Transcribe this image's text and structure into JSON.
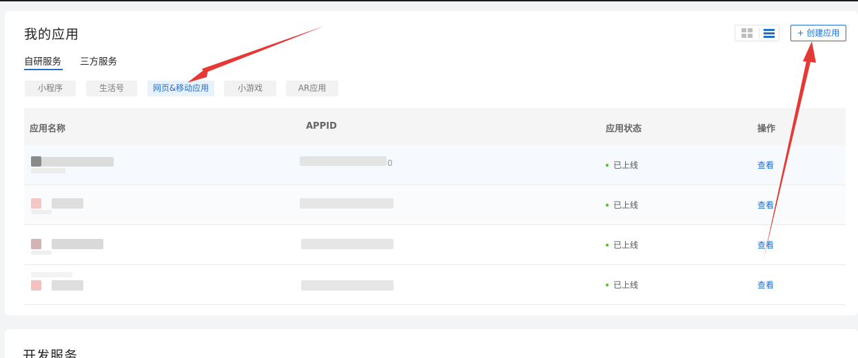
{
  "header": {
    "title": "我的应用",
    "create_button": "+ 创建应用"
  },
  "tabs": [
    {
      "label": "自研服务",
      "active": true
    },
    {
      "label": "三方服务",
      "active": false
    }
  ],
  "filters": [
    {
      "label": "小程序",
      "active": false
    },
    {
      "label": "生活号",
      "active": false
    },
    {
      "label": "网页&移动应用",
      "active": true
    },
    {
      "label": "小游戏",
      "active": false
    },
    {
      "label": "AR应用",
      "active": false
    }
  ],
  "table": {
    "columns": [
      "应用名称",
      "APPID",
      "应用状态",
      "操作"
    ],
    "rows": [
      {
        "appid_tail": "0",
        "status": "已上线",
        "action": "查看"
      },
      {
        "appid_tail": "",
        "status": "已上线",
        "action": "查看"
      },
      {
        "appid_tail": "",
        "status": "已上线",
        "action": "查看"
      },
      {
        "appid_tail": "",
        "status": "已上线",
        "action": "查看"
      }
    ]
  },
  "section2": {
    "title": "开发服务"
  },
  "colors": {
    "accent": "#1e6fd0",
    "status_online": "#52c41a",
    "annotation_arrow": "#e53935"
  },
  "icons": {
    "grid_view": "grid-view-icon",
    "list_view": "list-view-icon"
  }
}
